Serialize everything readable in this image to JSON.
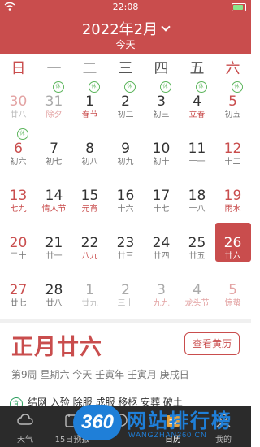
{
  "status_bar": {
    "time": "22:08"
  },
  "header": {
    "month_label": "2022年2月",
    "today_button": "今天"
  },
  "weekdays": [
    "日",
    "一",
    "二",
    "三",
    "四",
    "五",
    "六"
  ],
  "colors": {
    "accent": "#c94d4d",
    "grey": "#aaaaaa",
    "dark": "#333333",
    "badge_green": "#5cb55c"
  },
  "calendar": {
    "days": [
      {
        "n": "30",
        "l": "廿八",
        "muted": true,
        "weekend": true,
        "tag": ""
      },
      {
        "n": "31",
        "l": "除夕",
        "muted": true,
        "festival": true,
        "tag": "休"
      },
      {
        "n": "1",
        "l": "春节",
        "festival": true,
        "tag": "休"
      },
      {
        "n": "2",
        "l": "初二",
        "tag": "休"
      },
      {
        "n": "3",
        "l": "初三",
        "tag": "休"
      },
      {
        "n": "4",
        "l": "立春",
        "festival": true,
        "tag": "休"
      },
      {
        "n": "5",
        "l": "初五",
        "weekend": true,
        "tag": "休"
      },
      {
        "n": "6",
        "l": "初六",
        "weekend": true,
        "tag": "休"
      },
      {
        "n": "7",
        "l": "初七"
      },
      {
        "n": "8",
        "l": "初八"
      },
      {
        "n": "9",
        "l": "初九"
      },
      {
        "n": "10",
        "l": "初十"
      },
      {
        "n": "11",
        "l": "十一"
      },
      {
        "n": "12",
        "l": "十二",
        "weekend": true
      },
      {
        "n": "13",
        "l": "七九",
        "weekend": true,
        "festival": true
      },
      {
        "n": "14",
        "l": "情人节",
        "festival": true
      },
      {
        "n": "15",
        "l": "元宵",
        "festival": true
      },
      {
        "n": "16",
        "l": "十六"
      },
      {
        "n": "17",
        "l": "十七"
      },
      {
        "n": "18",
        "l": "十八"
      },
      {
        "n": "19",
        "l": "雨水",
        "weekend": true,
        "festival": true
      },
      {
        "n": "20",
        "l": "二十",
        "weekend": true
      },
      {
        "n": "21",
        "l": "廿一"
      },
      {
        "n": "22",
        "l": "八九",
        "festival": true
      },
      {
        "n": "23",
        "l": "廿三"
      },
      {
        "n": "24",
        "l": "廿四"
      },
      {
        "n": "25",
        "l": "廿五"
      },
      {
        "n": "26",
        "l": "廿六",
        "weekend": true,
        "selected": true
      },
      {
        "n": "27",
        "l": "廿七",
        "weekend": true
      },
      {
        "n": "28",
        "l": "廿八"
      },
      {
        "n": "1",
        "l": "廿九",
        "muted": true
      },
      {
        "n": "2",
        "l": "三十",
        "muted": true
      },
      {
        "n": "3",
        "l": "九九",
        "muted": true,
        "festival": true
      },
      {
        "n": "4",
        "l": "龙头节",
        "muted": true,
        "festival": true
      },
      {
        "n": "5",
        "l": "惊蛰",
        "muted": true,
        "weekend": true,
        "festival": true
      }
    ]
  },
  "detail": {
    "lunar_date": "正月廿六",
    "almanac_button": "查看黄历",
    "ganzhi": "第9周 星期六 今天 壬寅年 壬寅月 庚戌日",
    "yi_badge": "宜",
    "yi_text": "结网 入殓 除服 成服 移柩 安葬 破土"
  },
  "tabs": [
    {
      "label": "天气",
      "icon": "cloud-icon"
    },
    {
      "label": "15日预报",
      "icon": "calendar-15-icon"
    },
    {
      "label": "",
      "icon": "alert-icon"
    },
    {
      "label": "日历",
      "icon": "calendar-icon",
      "active": true
    },
    {
      "label": "我的",
      "icon": "person-icon"
    }
  ],
  "watermark": {
    "logo": "360",
    "text": "网站排行榜",
    "url": "WANGZHAN360.CN"
  }
}
